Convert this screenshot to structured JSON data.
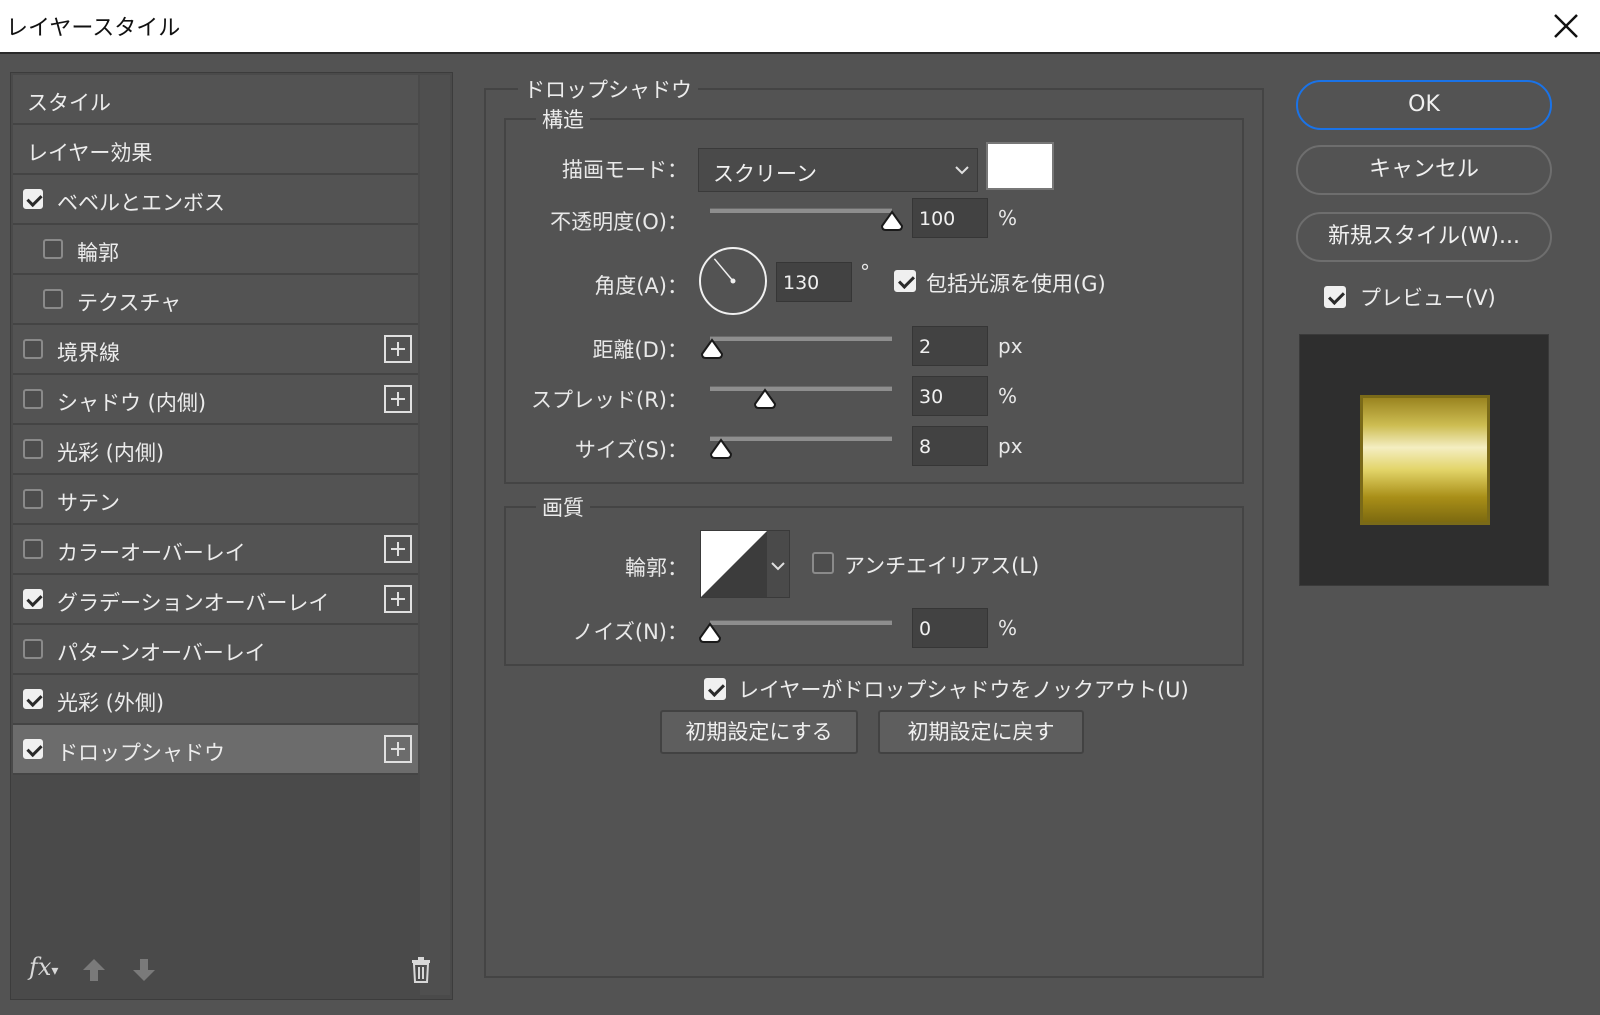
{
  "window": {
    "title": "レイヤースタイル"
  },
  "left": {
    "items": [
      {
        "label": "スタイル",
        "checkbox": null,
        "indent": false,
        "plus": false,
        "selected": false
      },
      {
        "label": "レイヤー効果",
        "checkbox": null,
        "indent": false,
        "plus": false,
        "selected": false
      },
      {
        "label": "ベベルとエンボス",
        "checkbox": true,
        "indent": false,
        "plus": false,
        "selected": false
      },
      {
        "label": "輪郭",
        "checkbox": false,
        "indent": true,
        "plus": false,
        "selected": false
      },
      {
        "label": "テクスチャ",
        "checkbox": false,
        "indent": true,
        "plus": false,
        "selected": false
      },
      {
        "label": "境界線",
        "checkbox": false,
        "indent": false,
        "plus": true,
        "selected": false
      },
      {
        "label": "シャドウ (内側)",
        "checkbox": false,
        "indent": false,
        "plus": true,
        "selected": false
      },
      {
        "label": "光彩 (内側)",
        "checkbox": false,
        "indent": false,
        "plus": false,
        "selected": false
      },
      {
        "label": "サテン",
        "checkbox": false,
        "indent": false,
        "plus": false,
        "selected": false
      },
      {
        "label": "カラーオーバーレイ",
        "checkbox": false,
        "indent": false,
        "plus": true,
        "selected": false
      },
      {
        "label": "グラデーションオーバーレイ",
        "checkbox": true,
        "indent": false,
        "plus": true,
        "selected": false
      },
      {
        "label": "パターンオーバーレイ",
        "checkbox": false,
        "indent": false,
        "plus": false,
        "selected": false
      },
      {
        "label": "光彩 (外側)",
        "checkbox": true,
        "indent": false,
        "plus": false,
        "selected": false
      },
      {
        "label": "ドロップシャドウ",
        "checkbox": true,
        "indent": false,
        "plus": true,
        "selected": true
      }
    ],
    "fx_label": "fx"
  },
  "drop_shadow": {
    "title": "ドロップシャドウ",
    "structure": {
      "title": "構造",
      "blend_mode_label": "描画モード：",
      "blend_mode_value": "スクリーン",
      "shadow_color": "#ffffff",
      "opacity_label": "不透明度(O)：",
      "opacity_value": "100",
      "opacity_unit": "%",
      "opacity_fraction": 1.0,
      "angle_label": "角度(A)：",
      "angle_value": "130",
      "angle_unit": "°",
      "angle_degrees": 130,
      "global_light_label": "包括光源を使用(G)",
      "global_light_checked": true,
      "distance_label": "距離(D)：",
      "distance_value": "2",
      "distance_unit": "px",
      "distance_fraction": 0.01,
      "spread_label": "スプレッド(R)：",
      "spread_value": "30",
      "spread_unit": "%",
      "spread_fraction": 0.3,
      "size_label": "サイズ(S)：",
      "size_value": "8",
      "size_unit": "px",
      "size_fraction": 0.06
    },
    "quality": {
      "title": "画質",
      "contour_label": "輪郭：",
      "antialias_label": "アンチエイリアス(L)",
      "antialias_checked": false,
      "noise_label": "ノイズ(N)：",
      "noise_value": "0",
      "noise_unit": "%",
      "noise_fraction": 0.0
    },
    "knockout_label": "レイヤーがドロップシャドウをノックアウト(U)",
    "knockout_checked": true,
    "make_default_label": "初期設定にする",
    "reset_default_label": "初期設定に戻す"
  },
  "right": {
    "ok_label": "OK",
    "cancel_label": "キャンセル",
    "new_style_label": "新規スタイル(W)...",
    "preview_label": "プレビュー(V)",
    "preview_checked": true
  },
  "colors": {
    "panel": "#535353",
    "accent": "#1a73e8"
  },
  "icons": [
    "close-icon",
    "fx-icon",
    "arrow-up-icon",
    "arrow-down-icon",
    "trash-icon",
    "plus-icon",
    "chevron-down-icon",
    "checkmark-icon"
  ]
}
